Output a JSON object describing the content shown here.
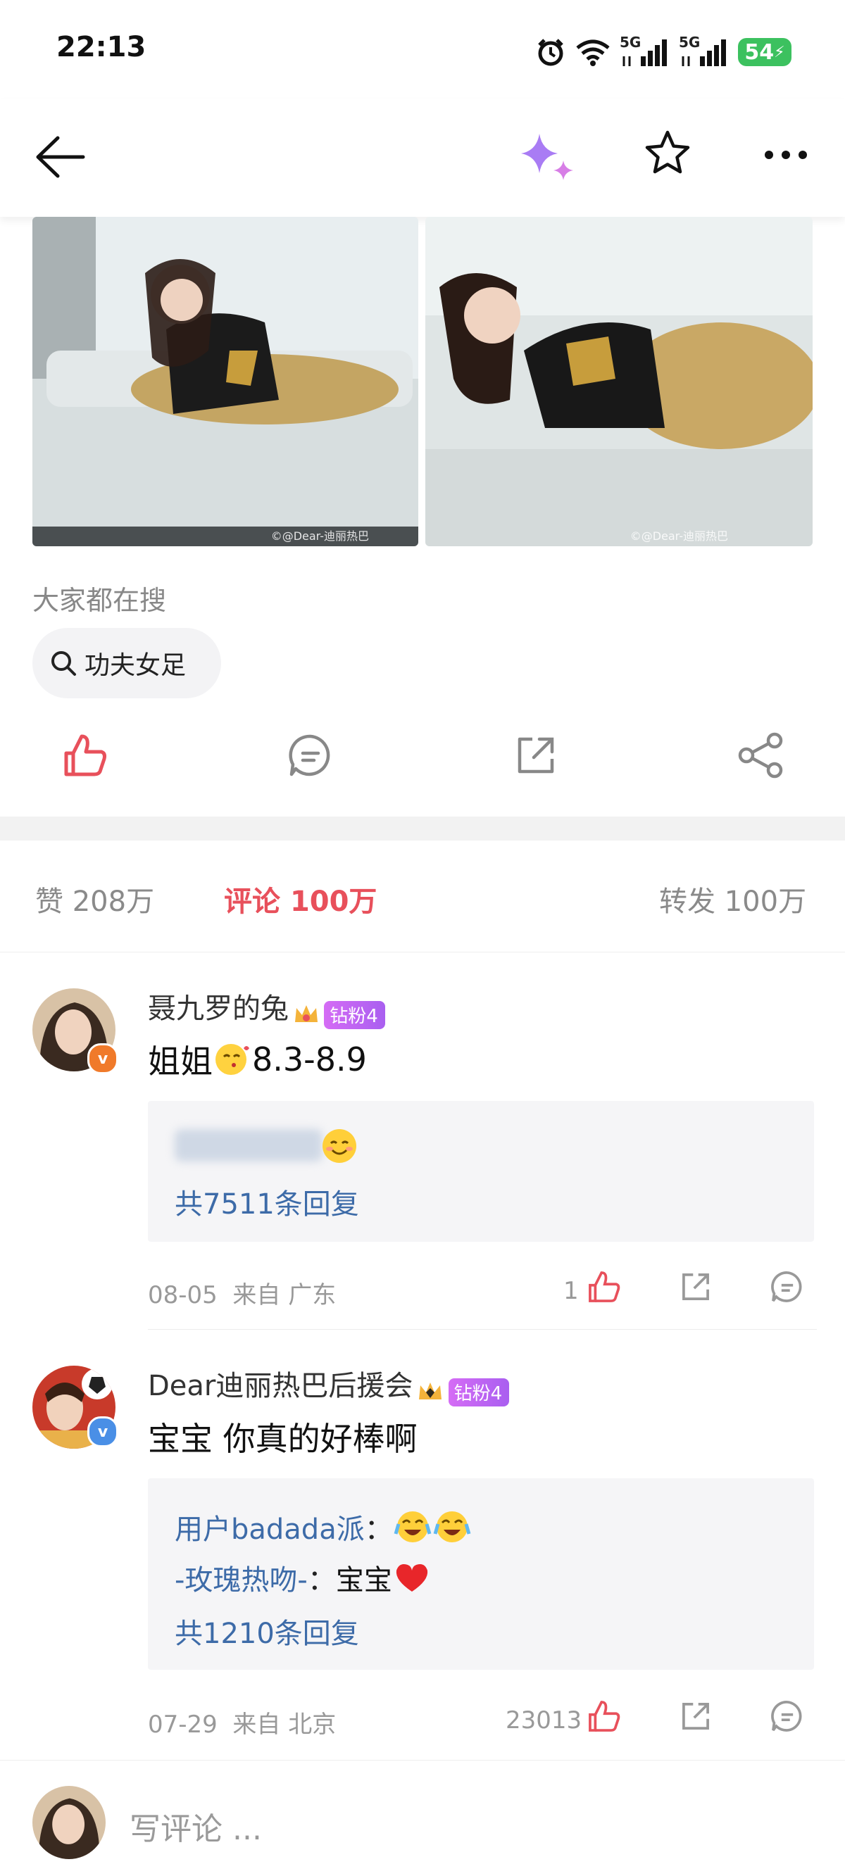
{
  "status_bar": {
    "time": "22:13",
    "net1": "5G",
    "net2": "5G",
    "battery": "54"
  },
  "post": {
    "photo_watermark_1": "©@Dear-迪丽热巴",
    "photo_watermark_2": "©@Dear-迪丽热巴",
    "hot_search_label": "大家都在搜",
    "hot_search_term": "功夫女足"
  },
  "tabs": {
    "likes_label": "赞",
    "likes_count": "208万",
    "comments_label": "评论",
    "comments_count": "100万",
    "reposts_label": "转发",
    "reposts_count": "100万"
  },
  "comments": [
    {
      "user": "聂九罗的兔",
      "badge": "钻粉4",
      "text_prefix": "姐姐",
      "text_suffix": "8.3-8.9",
      "replies": [],
      "reply_count_text": "共7511条回复",
      "date": "08-05",
      "location": "来自 广东",
      "likes": "1"
    },
    {
      "user": "Dear迪丽热巴后援会",
      "badge": "钻粉4",
      "text": "宝宝 你真的好棒啊",
      "replies": [
        {
          "user": "用户badada派",
          "sep": "：",
          "text": ""
        },
        {
          "user": "-玫瑰热吻-",
          "sep": "：",
          "text": "宝宝"
        }
      ],
      "reply_count_text": "共1210条回复",
      "date": "07-29",
      "location": "来自 北京",
      "likes": "23013"
    }
  ],
  "bottom": {
    "comment_placeholder": "写评论 ..."
  },
  "colors": {
    "accent": "#e8505b",
    "link": "#3d6ba8",
    "badge": "#b463f2",
    "battery": "#3cc15f"
  }
}
